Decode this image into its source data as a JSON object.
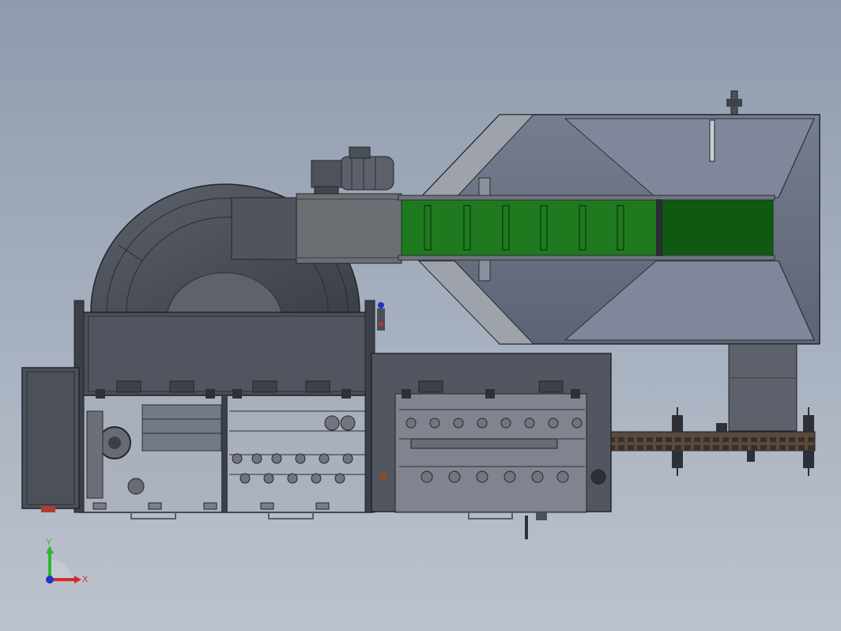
{
  "viewport": {
    "background_top": "#8f9bad",
    "background_bottom": "#bcc3ce"
  },
  "model": {
    "body_color": "#4a4f59",
    "panel_color": "#555a63",
    "hopper_color": "#6d7485",
    "conveyor_color": "#1f7a1f",
    "conveyor_dark_color": "#0f5a10",
    "machine_parts": [
      "drum-tank",
      "drive-motor",
      "feed-hopper",
      "incline-conveyor",
      "main-machine-frame",
      "transmission-frame",
      "chain-outfeed-conveyor",
      "control-box"
    ]
  },
  "triad": {
    "y_label": "Y",
    "x_label": "X",
    "y_color": "#2db82d",
    "x_color": "#d42a2a",
    "z_color": "#2233cc"
  }
}
